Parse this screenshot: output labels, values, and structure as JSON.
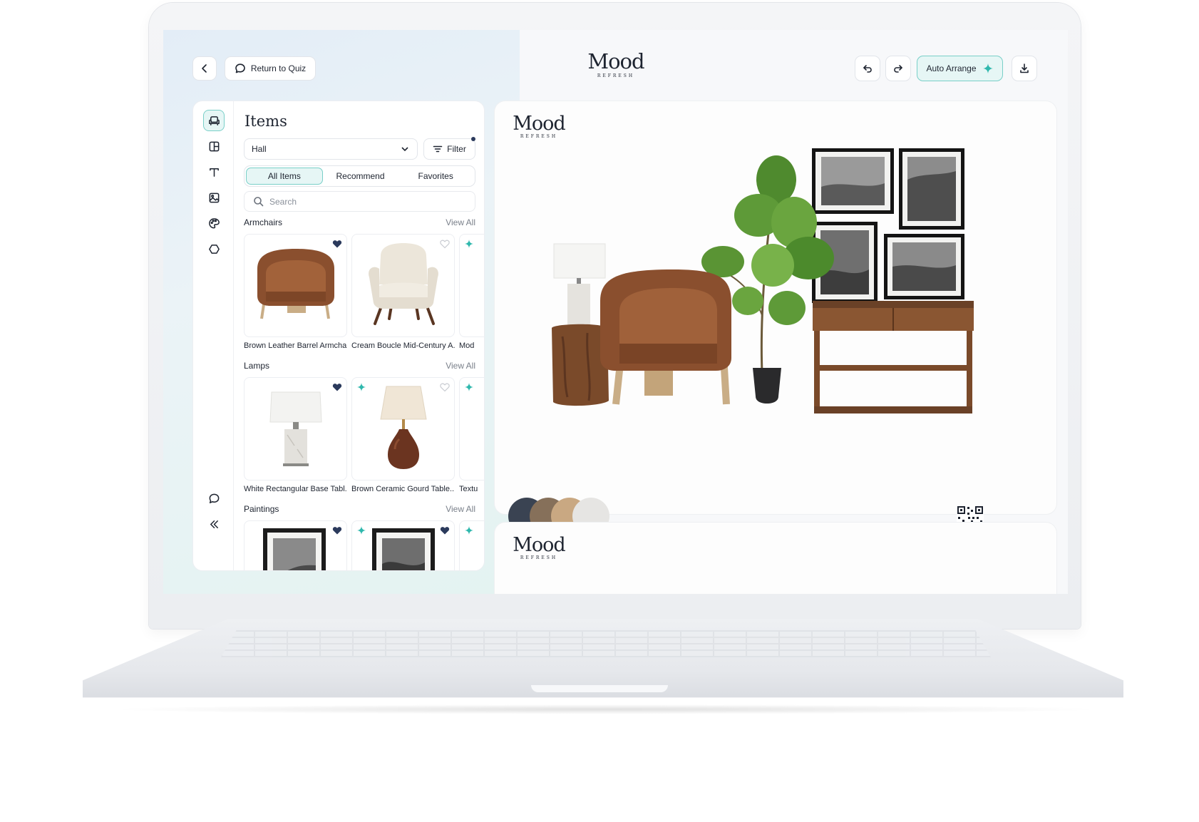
{
  "app": {
    "brand_name": "Mood",
    "brand_tagline": "REFRESH"
  },
  "toolbar": {
    "return_label": "Return to Quiz",
    "auto_arrange_label": "Auto Arrange"
  },
  "panel": {
    "title": "Items",
    "room_select_value": "Hall",
    "filter_label": "Filter",
    "tabs": [
      {
        "label": "All Items",
        "active": true
      },
      {
        "label": "Recommend",
        "active": false
      },
      {
        "label": "Favorites",
        "active": false
      }
    ],
    "search_placeholder": "Search",
    "view_all_label": "View All",
    "sections": [
      {
        "title": "Armchairs",
        "items": [
          {
            "caption": "Brown Leather Barrel Armchair",
            "favorited": true,
            "recommended": false
          },
          {
            "caption": "Cream Boucle Mid-Century A...",
            "favorited": false,
            "recommended": false
          },
          {
            "caption": "Mod",
            "favorited": false,
            "recommended": true
          }
        ]
      },
      {
        "title": "Lamps",
        "items": [
          {
            "caption": "White Rectangular Base Tabl...",
            "favorited": true,
            "recommended": false
          },
          {
            "caption": "Brown Ceramic Gourd Table...",
            "favorited": false,
            "recommended": true
          },
          {
            "caption": "Textu",
            "favorited": false,
            "recommended": true
          }
        ]
      },
      {
        "title": "Paintings",
        "items": [
          {
            "caption": "",
            "favorited": true,
            "recommended": false
          },
          {
            "caption": "",
            "favorited": true,
            "recommended": true
          },
          {
            "caption": "",
            "favorited": false,
            "recommended": true
          }
        ]
      }
    ]
  },
  "moodboard": {
    "palette": [
      "#3a4352",
      "#86705a",
      "#c9a882",
      "#e6e5e3"
    ]
  },
  "colors": {
    "accent": "#79cfc8",
    "accent_bg": "#e6f6f5",
    "heart": "#2b3a5c",
    "sparkle": "#2fb8ad"
  }
}
